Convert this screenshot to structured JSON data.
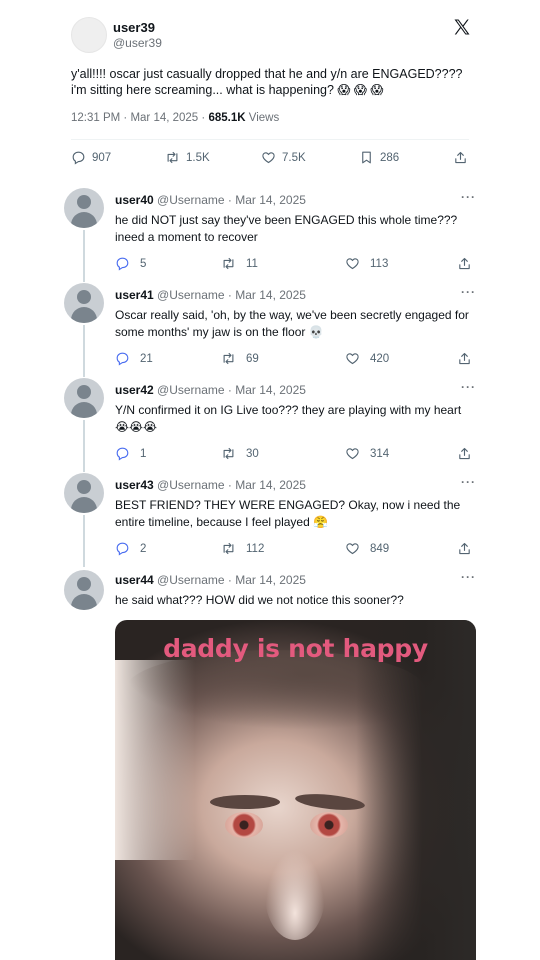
{
  "main_tweet": {
    "username": "user39",
    "handle": "@user39",
    "text": "y'all!!!! oscar just casually dropped that he and y/n are ENGAGED???? i'm sitting here screaming... what is happening? 😱 😱 😱",
    "time": "12:31 PM · Mar 14, 2025 · ",
    "views_count": "685.1K",
    "views_label": " Views",
    "replies": "907",
    "retweets": "1.5K",
    "likes": "7.5K",
    "bookmarks": "286"
  },
  "replies": [
    {
      "user": "user40",
      "meta": " @Username · Mar 14, 2025",
      "text": "he did NOT just say they've been ENGAGED this whole time??? ineed a moment to recover",
      "replies": "5",
      "retweets": "11",
      "likes": "113"
    },
    {
      "user": "user41",
      "meta": " @Username · Mar 14, 2025",
      "text": "Oscar really said, 'oh, by the way, we've been secretly engaged for some months' my jaw is on the floor 💀",
      "replies": "21",
      "retweets": "69",
      "likes": "420"
    },
    {
      "user": "user42",
      "meta": " @Username · Mar 14, 2025",
      "text": "Y/N confirmed it on IG Live too??? they are playing with my heart 😭😭😭",
      "replies": "1",
      "retweets": "30",
      "likes": "314"
    },
    {
      "user": "user43",
      "meta": " @Username · Mar 14, 2025",
      "text": "BEST FRIEND? THEY WERE ENGAGED? Okay, now i need the entire timeline, because I feel played 😤",
      "replies": "2",
      "retweets": "112",
      "likes": "849"
    },
    {
      "user": "user44",
      "meta": " @Username · Mar 14, 2025",
      "text": "he said what??? HOW did we not notice this sooner??"
    }
  ],
  "more_label": "···",
  "meme_caption": "daddy is not happy",
  "colors": {
    "text": "#0f1419",
    "secondary": "#6b7177",
    "caption": "#e35a7e"
  }
}
